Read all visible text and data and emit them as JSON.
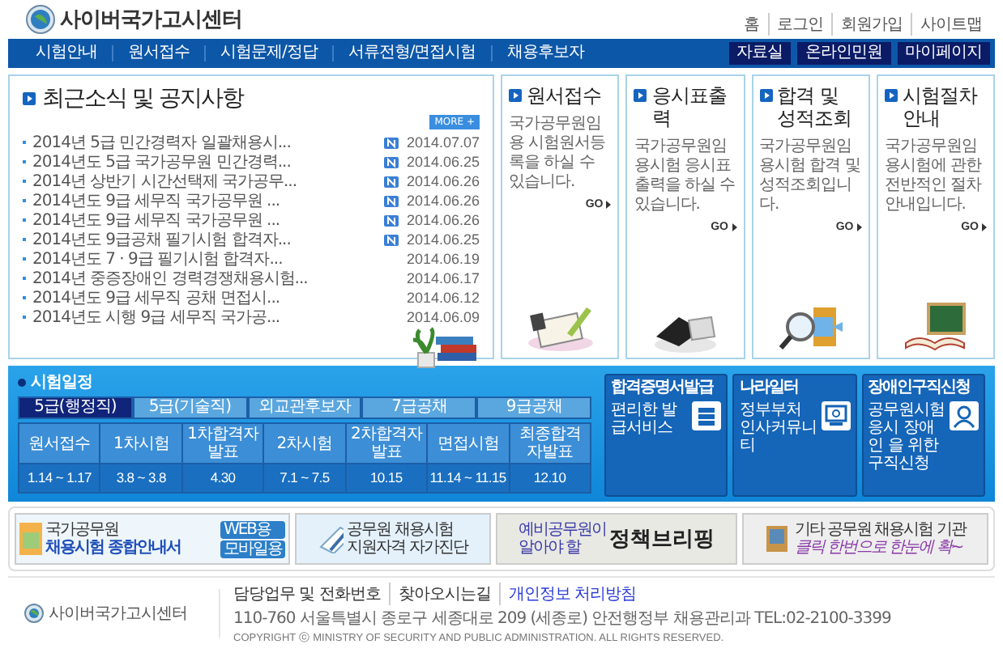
{
  "header": {
    "logo_text": "사이버국가고시센터",
    "top_links": [
      "홈",
      "로그인",
      "회원가입",
      "사이트맵"
    ],
    "nav": [
      "시험안내",
      "원서접수",
      "시험문제/정답",
      "서류전형/면접시험",
      "채용후보자"
    ],
    "nav_buttons": [
      "자료실",
      "온라인민원",
      "마이페이지"
    ]
  },
  "news": {
    "title": "최근소식 및 공지사항",
    "more": "MORE +",
    "items": [
      {
        "title": "2014년 5급 민간경력자 일괄채용시...",
        "new": true,
        "date": "2014.07.07"
      },
      {
        "title": "2014년도 5급 국가공무원 민간경력...",
        "new": true,
        "date": "2014.06.25"
      },
      {
        "title": "2014년 상반기 시간선택제 국가공무...",
        "new": true,
        "date": "2014.06.26"
      },
      {
        "title": "2014년도 9급 세무직 국가공무원 ...",
        "new": true,
        "date": "2014.06.26"
      },
      {
        "title": "2014년도 9급 세무직 국가공무원 ...",
        "new": true,
        "date": "2014.06.26"
      },
      {
        "title": "2014년도 9급공채 필기시험 합격자...",
        "new": true,
        "date": "2014.06.25"
      },
      {
        "title": "2014년도 7 · 9급 필기시험 합격자...",
        "new": false,
        "date": "2014.06.19"
      },
      {
        "title": "2014년 중증장애인 경력경쟁채용시험...",
        "new": false,
        "date": "2014.06.17"
      },
      {
        "title": "2014년도 9급 세무직 공채 면접시...",
        "new": false,
        "date": "2014.06.12"
      },
      {
        "title": "2014년도 시행 9급 세무직 국가공...",
        "new": false,
        "date": "2014.06.09"
      }
    ]
  },
  "cards": [
    {
      "kind": "notepad",
      "title": "원서접수",
      "description": "국가공무원임용 시험원서등록을 하실 수 있습니다.",
      "go": "GO"
    },
    {
      "kind": "laptop",
      "title": "응시표출력",
      "description": "국가공무원임용시험 응시표 출력을 하실 수 있습니다.",
      "go": "GO"
    },
    {
      "kind": "magnifier",
      "title": "합격 및 성적조회",
      "description": "국가공무원임용시험 합격 및 성적조회입니다.",
      "go": "GO"
    },
    {
      "kind": "chalkboard",
      "title": "시험절차안내",
      "description": "국가공무원임용시험에 관한 전반적인 절차안내입니다.",
      "go": "GO"
    }
  ],
  "schedule": {
    "label": "시험일정",
    "tabs": [
      {
        "label": "5급(행정직)",
        "selected": true
      },
      {
        "label": "5급(기술직)",
        "selected": false
      },
      {
        "label": "외교관후보자",
        "selected": false
      },
      {
        "label": "7급공채",
        "selected": false
      },
      {
        "label": "9급공채",
        "selected": false
      }
    ],
    "columns": [
      "원서접수",
      "1차시험",
      "1차합격자발표",
      "2차시험",
      "2차합격자발표",
      "면접시험",
      "최종합격자발표"
    ],
    "values": [
      "1.14 ~ 1.17",
      "3.8 ~ 3.8",
      "4.30",
      "7.1 ~ 7.5",
      "10.15",
      "11.14 ~ 11.15",
      "12.10"
    ]
  },
  "services": [
    {
      "kind": "books",
      "title": "합격증명서발급",
      "description": "편리한 발급서비스"
    },
    {
      "kind": "monitor",
      "title": "나라일터",
      "description": "정부부처 인사커뮤니티"
    },
    {
      "kind": "person",
      "title": "장애인구직신청",
      "description": "공무원시험 응시 장애인 을 위한 구직신청"
    }
  ],
  "banners": [
    {
      "kind": "guide",
      "lines": [
        "국가공무원",
        "채용시험 종합안내서"
      ],
      "buttons": [
        "WEB용",
        "모바일용"
      ]
    },
    {
      "kind": "selfcheck",
      "lines": [
        "공무원 채용시험",
        "지원자격 자가진단"
      ]
    },
    {
      "kind": "policy",
      "lines": [
        "예비공무원이",
        "알아야 할"
      ],
      "headline": "정책브리핑"
    },
    {
      "kind": "other",
      "lines": [
        "기타 공무원 채용시험 기관"
      ],
      "subline": "클릭 한번으로 한눈에 확~"
    }
  ],
  "footer": {
    "logo_text": "사이버국가고시센터",
    "links": [
      {
        "label": "담당업무 및 전화번호",
        "highlight": false
      },
      {
        "label": "찾아오시는길",
        "highlight": false
      },
      {
        "label": "개인정보 처리방침",
        "highlight": true
      }
    ],
    "address": "110-760 서울특별시 종로구 세종대로 209 (세종로) 안전행정부 채용관리과 TEL:02-2100-3399",
    "copyright": "COPYRIGHT ⓒ MINISTRY OF SECURITY AND PUBLIC ADMINISTRATION. ALL RIGHTS RESERVED."
  }
}
